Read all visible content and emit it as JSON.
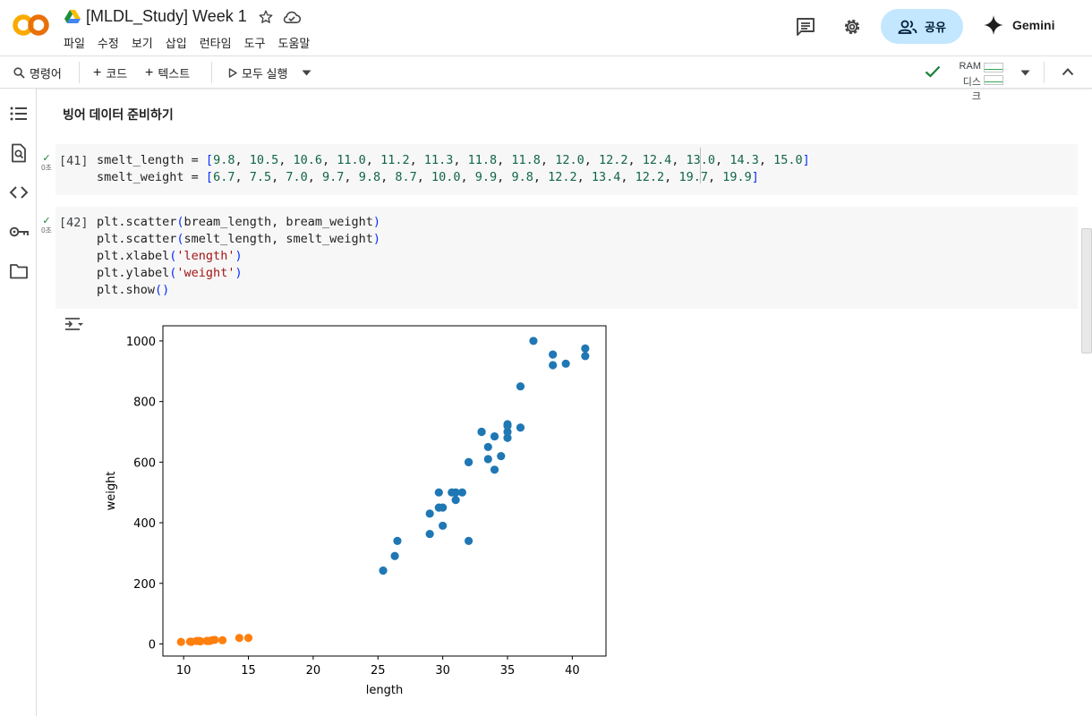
{
  "header": {
    "doc_title": "[MLDL_Study] Week 1",
    "menu": [
      "파일",
      "수정",
      "보기",
      "삽입",
      "런타임",
      "도구",
      "도움말"
    ],
    "share_label": "공유",
    "gemini_label": "Gemini"
  },
  "toolbar": {
    "commands_label": "명령어",
    "add_code_label": "코드",
    "add_text_label": "텍스트",
    "run_all_label": "모두 실행",
    "ram_label": "RAM",
    "disk_label": "디스크"
  },
  "section_title": "빙어 데이터 준비하기",
  "cells": [
    {
      "exec_count": "[41]",
      "status_time": "0초",
      "lines": [
        "smelt_length = [9.8, 10.5, 10.6, 11.0, 11.2, 11.3, 11.8, 11.8, 12.0, 12.2, 12.4, 13.0, 14.3, 15.0]",
        "smelt_weight = [6.7, 7.5, 7.0, 9.7, 9.8, 8.7, 10.0, 9.9, 9.8, 12.2, 13.4, 12.2, 19.7, 19.9]"
      ]
    },
    {
      "exec_count": "[42]",
      "status_time": "0초",
      "lines": [
        "plt.scatter(bream_length, bream_weight)",
        "plt.scatter(smelt_length, smelt_weight)",
        "plt.xlabel('length')",
        "plt.ylabel('weight')",
        "plt.show()"
      ]
    }
  ],
  "chart_data": {
    "type": "scatter",
    "xlabel": "length",
    "ylabel": "weight",
    "xlim": [
      8.4,
      42.6
    ],
    "ylim": [
      -40,
      1050
    ],
    "x_ticks": [
      10,
      15,
      20,
      25,
      30,
      35,
      40
    ],
    "y_ticks": [
      0,
      200,
      400,
      600,
      800,
      1000
    ],
    "grid": false,
    "series": [
      {
        "color": "#1f77b4",
        "x": [
          25.4,
          26.3,
          26.5,
          29.0,
          29.0,
          29.7,
          29.7,
          30.0,
          30.0,
          30.7,
          31.0,
          31.0,
          31.5,
          32.0,
          32.0,
          32.0,
          33.0,
          33.0,
          33.5,
          33.5,
          34.0,
          34.0,
          34.5,
          35.0,
          35.0,
          35.0,
          35.0,
          36.0,
          36.0,
          37.0,
          38.5,
          38.5,
          39.5,
          41.0,
          41.0
        ],
        "y": [
          242,
          290,
          340,
          363,
          430,
          450,
          500,
          390,
          450,
          500,
          475,
          500,
          500,
          340,
          600,
          600,
          700,
          700,
          610,
          650,
          575,
          685,
          620,
          680,
          700,
          725,
          720,
          714,
          850,
          1000,
          920,
          955,
          925,
          975,
          950
        ]
      },
      {
        "color": "#ff7f0e",
        "x": [
          9.8,
          10.5,
          10.6,
          11.0,
          11.2,
          11.3,
          11.8,
          11.8,
          12.0,
          12.2,
          12.4,
          13.0,
          14.3,
          15.0
        ],
        "y": [
          6.7,
          7.5,
          7.0,
          9.7,
          9.8,
          8.7,
          10.0,
          9.9,
          9.8,
          12.2,
          13.4,
          12.2,
          19.7,
          19.9
        ]
      }
    ]
  }
}
